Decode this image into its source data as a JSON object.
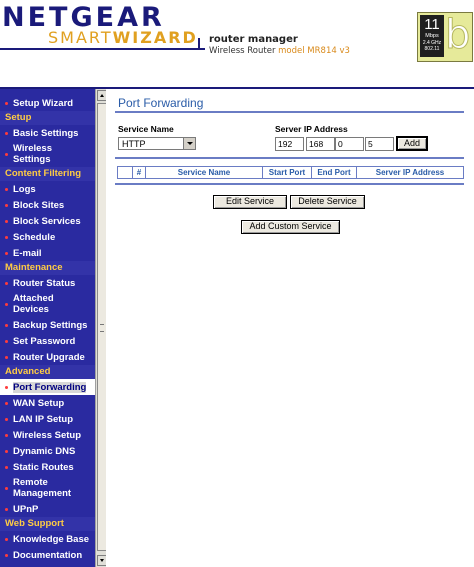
{
  "header": {
    "brand": "NETGEAR",
    "brand_sub_pre": "SMART",
    "brand_sub_bold": "WIZARD",
    "title": "router manager",
    "subtitle": "Wireless Router",
    "model": "model MR814 v3",
    "badge": {
      "speed": "11",
      "unit": "Mbps",
      "freq": "2.4 GHz",
      "std": "802.11",
      "letter": "b"
    }
  },
  "sidebar": {
    "items": [
      {
        "type": "item",
        "label": "Setup Wizard"
      },
      {
        "type": "section",
        "label": "Setup"
      },
      {
        "type": "item",
        "label": "Basic Settings"
      },
      {
        "type": "item",
        "label": "Wireless Settings",
        "tall": true
      },
      {
        "type": "section",
        "label": "Content Filtering"
      },
      {
        "type": "item",
        "label": "Logs"
      },
      {
        "type": "item",
        "label": "Block Sites"
      },
      {
        "type": "item",
        "label": "Block Services"
      },
      {
        "type": "item",
        "label": "Schedule"
      },
      {
        "type": "item",
        "label": "E-mail"
      },
      {
        "type": "section",
        "label": "Maintenance"
      },
      {
        "type": "item",
        "label": "Router Status"
      },
      {
        "type": "item",
        "label": "Attached Devices",
        "tall": true
      },
      {
        "type": "item",
        "label": "Backup Settings"
      },
      {
        "type": "item",
        "label": "Set Password"
      },
      {
        "type": "item",
        "label": "Router Upgrade"
      },
      {
        "type": "section",
        "label": "Advanced"
      },
      {
        "type": "item",
        "label": "Port Forwarding",
        "active": true
      },
      {
        "type": "item",
        "label": "WAN Setup"
      },
      {
        "type": "item",
        "label": "LAN IP Setup"
      },
      {
        "type": "item",
        "label": "Wireless Setup"
      },
      {
        "type": "item",
        "label": "Dynamic DNS"
      },
      {
        "type": "item",
        "label": "Static Routes"
      },
      {
        "type": "item",
        "label": "Remote Management",
        "tall": true
      },
      {
        "type": "item",
        "label": "UPnP"
      },
      {
        "type": "section",
        "label": "Web Support"
      },
      {
        "type": "item",
        "label": "Knowledge Base"
      },
      {
        "type": "item",
        "label": "Documentation"
      }
    ]
  },
  "main": {
    "title": "Port Forwarding",
    "service_name_label": "Service Name",
    "service_value": "HTTP",
    "server_ip_label": "Server IP Address",
    "ip": [
      "192",
      "168",
      "0",
      "5"
    ],
    "add_label": "Add",
    "table_headers": [
      "",
      "#",
      "Service Name",
      "Start Port",
      "End Port",
      "Server IP Address"
    ],
    "edit_label": "Edit Service",
    "delete_label": "Delete Service",
    "add_custom_label": "Add Custom Service"
  },
  "colors": {
    "sidebar_bg": "#2a2aa0",
    "section_text": "#ffcc44",
    "bullet": "#ff3c3c",
    "title_blue": "#2a5ca8",
    "brand_navy": "#1a1a7a",
    "brand_gold": "#e0a020"
  }
}
